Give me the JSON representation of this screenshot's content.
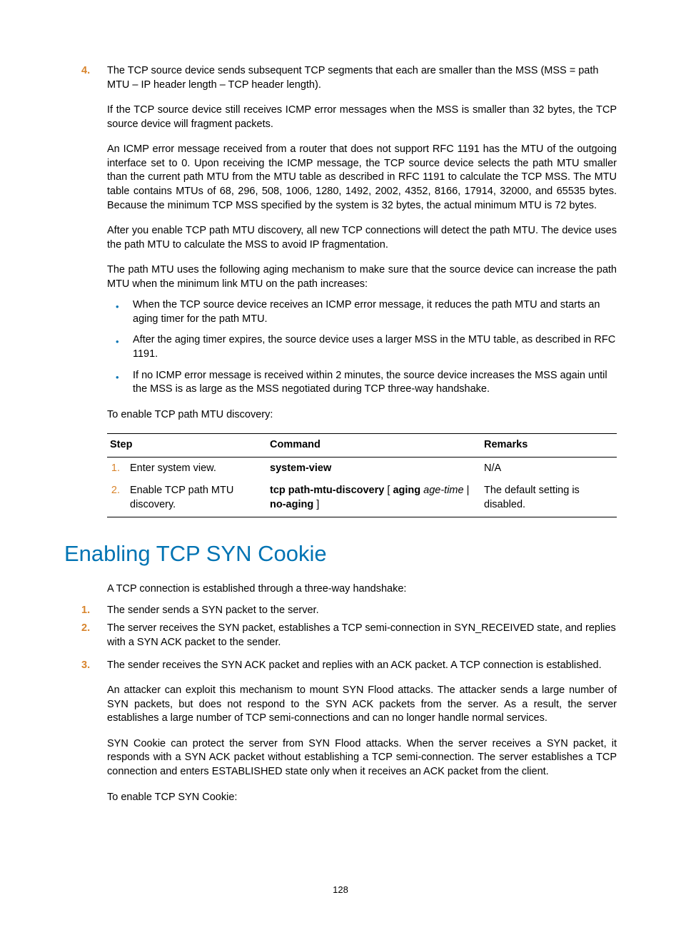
{
  "intro_list": {
    "items": [
      {
        "num": "4.",
        "text": "The TCP source device sends subsequent TCP segments that each are smaller than the MSS (MSS = path MTU – IP header length – TCP header length)."
      }
    ]
  },
  "para1": "If the TCP source device still receives ICMP error messages when the MSS is smaller than 32 bytes, the TCP source device will fragment packets.",
  "para2": "An ICMP error message received from a router that does not support RFC 1191 has the MTU of the outgoing interface set to 0. Upon receiving the ICMP message, the TCP source device selects the path MTU smaller than the current path MTU from the MTU table as described in RFC 1191 to calculate the TCP MSS. The MTU table contains MTUs of 68, 296, 508, 1006, 1280, 1492, 2002, 4352, 8166, 17914, 32000, and 65535 bytes. Because the minimum TCP MSS specified by the system is 32 bytes, the actual minimum MTU is 72 bytes.",
  "para3": "After you enable TCP path MTU discovery, all new TCP connections will detect the path MTU. The device uses the path MTU to calculate the MSS to avoid IP fragmentation.",
  "para4": "The path MTU uses the following aging mechanism to make sure that the source device can increase the path MTU when the minimum link MTU on the path increases:",
  "bullets": [
    "When the TCP source device receives an ICMP error message, it reduces the path MTU and starts an aging timer for the path MTU.",
    "After the aging timer expires, the source device uses a larger MSS in the MTU table, as described in RFC 1191.",
    "If no ICMP error message is received within 2 minutes, the source device increases the MSS again until the MSS is as large as the MSS negotiated during TCP three-way handshake."
  ],
  "para5": "To enable TCP path MTU discovery:",
  "table1": {
    "headers": {
      "step": "Step",
      "command": "Command",
      "remarks": "Remarks"
    },
    "rows": [
      {
        "num": "1.",
        "step": "Enter system view.",
        "cmd_bold1": "system-view",
        "cmd_rest": "",
        "remarks": "N/A"
      },
      {
        "num": "2.",
        "step": "Enable TCP path MTU discovery.",
        "cmd_bold1": "tcp path-mtu-discovery",
        "cmd_plain1": " [ ",
        "cmd_bold2": "aging",
        "cmd_italic1": " age-time",
        "cmd_plain2": " | ",
        "cmd_bold3": "no-aging",
        "cmd_plain3": " ]",
        "remarks": "The default setting is disabled."
      }
    ]
  },
  "heading": "Enabling TCP SYN Cookie",
  "para6": "A TCP connection is established through a three-way handshake:",
  "ol2": [
    {
      "num": "1.",
      "text": "The sender sends a SYN packet to the server."
    },
    {
      "num": "2.",
      "text": "The server receives the SYN packet, establishes a TCP semi-connection in SYN_RECEIVED state, and replies with a SYN ACK packet to the sender."
    },
    {
      "num": "3.",
      "text": "The sender receives the SYN ACK packet and replies with an ACK packet. A TCP connection is established."
    }
  ],
  "para7": "An attacker can exploit this mechanism to mount SYN Flood attacks. The attacker sends a large number of SYN packets, but does not respond to the SYN ACK packets from the server. As a result, the server establishes a large number of TCP semi-connections and can no longer handle normal services.",
  "para8": "SYN Cookie can protect the server from SYN Flood attacks. When the server receives a SYN packet, it responds with a SYN ACK packet without establishing a TCP semi-connection. The server establishes a TCP connection and enters ESTABLISHED state only when it receives an ACK packet from the client.",
  "para9": "To enable TCP SYN Cookie:",
  "pagenum": "128"
}
